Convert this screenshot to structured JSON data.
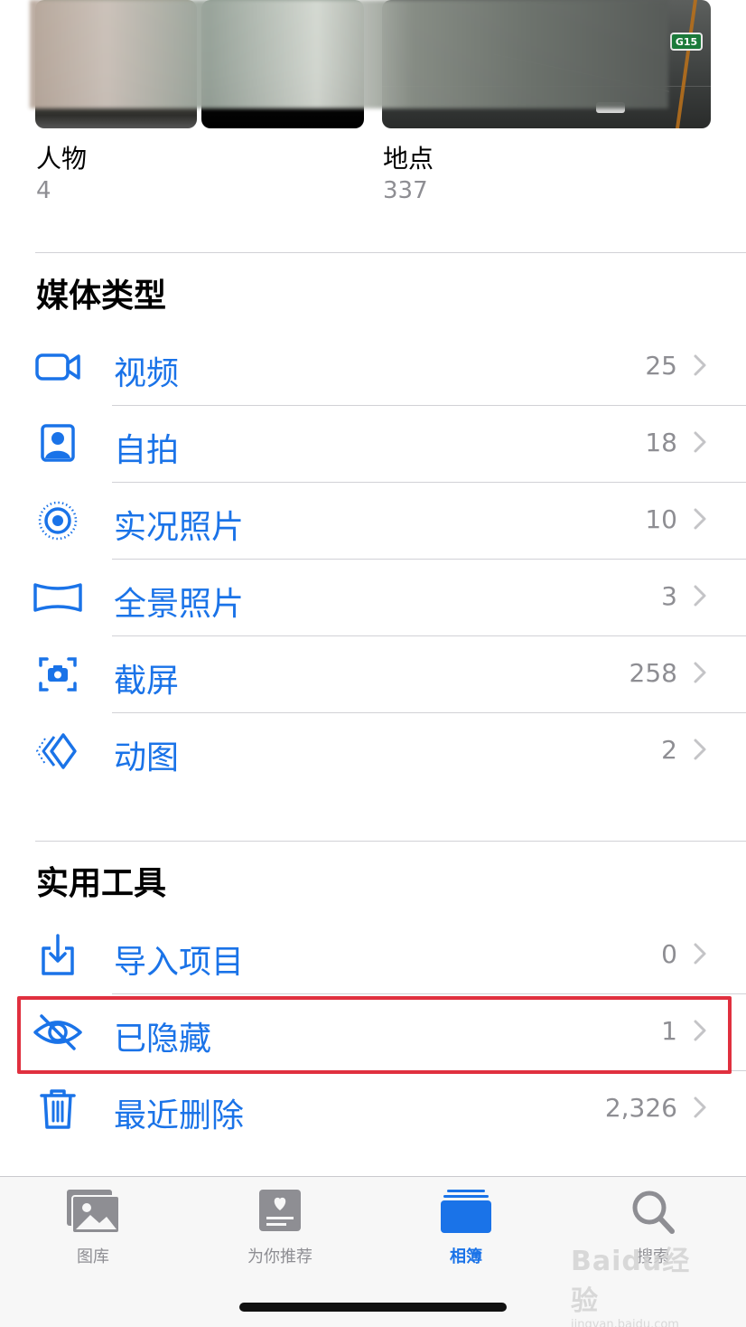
{
  "albums": [
    {
      "title": "人物",
      "count": "4"
    },
    {
      "title": "地点",
      "count": "337"
    }
  ],
  "map_badge": "G15",
  "media_types": {
    "title": "媒体类型",
    "items": [
      {
        "label": "视频",
        "count": "25",
        "icon": "video-camera-icon"
      },
      {
        "label": "自拍",
        "count": "18",
        "icon": "selfie-portrait-icon"
      },
      {
        "label": "实况照片",
        "count": "10",
        "icon": "live-photo-icon"
      },
      {
        "label": "全景照片",
        "count": "3",
        "icon": "panorama-icon"
      },
      {
        "label": "截屏",
        "count": "258",
        "icon": "screenshot-icon"
      },
      {
        "label": "动图",
        "count": "2",
        "icon": "animated-icon"
      }
    ]
  },
  "utilities": {
    "title": "实用工具",
    "items": [
      {
        "label": "导入项目",
        "count": "0",
        "icon": "import-icon"
      },
      {
        "label": "已隐藏",
        "count": "1",
        "icon": "hidden-eye-slash-icon",
        "highlighted": true
      },
      {
        "label": "最近删除",
        "count": "2,326",
        "icon": "trash-icon"
      }
    ]
  },
  "tabbar": {
    "tabs": [
      {
        "label": "图库",
        "icon": "photo-library-icon",
        "active": false
      },
      {
        "label": "为你推荐",
        "icon": "for-you-icon",
        "active": false
      },
      {
        "label": "相簿",
        "icon": "albums-icon",
        "active": true
      },
      {
        "label": "搜索",
        "icon": "search-icon",
        "active": false
      }
    ]
  },
  "watermark": {
    "main": "Baidu经验",
    "sub": "jingyan.baidu.com"
  },
  "colors": {
    "accent": "#1a73e8",
    "secondary_text": "#8e8e93",
    "highlight": "#e0303f",
    "separator": "#d1d1d6"
  }
}
